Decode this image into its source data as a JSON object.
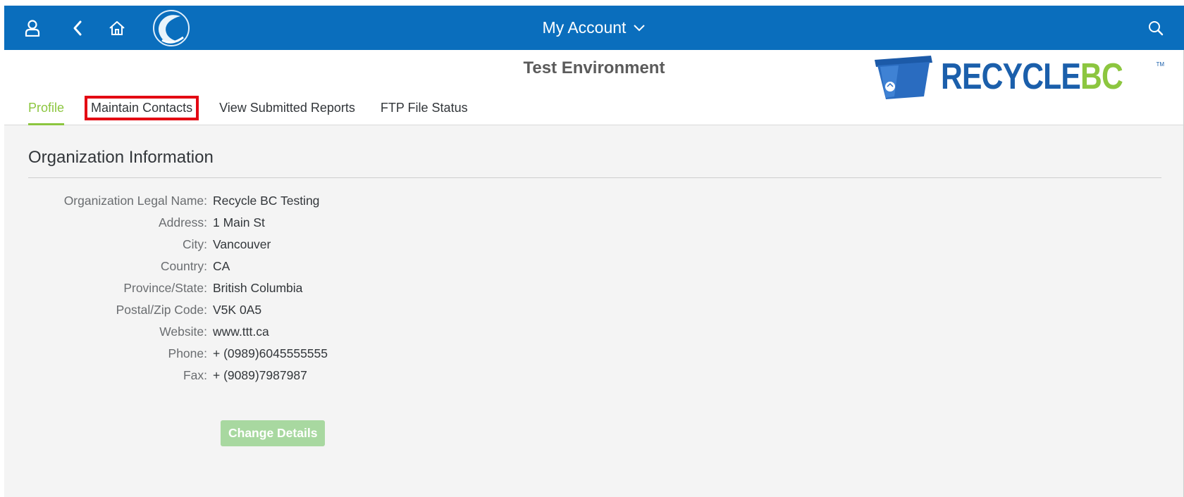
{
  "shell": {
    "title": "My Account",
    "icons": [
      "person-icon",
      "back-icon",
      "home-icon",
      "app-logo",
      "chevron-down-icon",
      "search-icon"
    ],
    "color": "#0a6ebd"
  },
  "header": {
    "environment": "Test Environment",
    "brand": {
      "part1": "RECYCLE",
      "part2": "BC",
      "tm": "TM",
      "colors": {
        "primary": "#1b5fab",
        "accent": "#8cc63f"
      }
    }
  },
  "tabs": [
    {
      "label": "Profile",
      "active": true
    },
    {
      "label": "Maintain Contacts",
      "highlighted": true
    },
    {
      "label": "View Submitted Reports"
    },
    {
      "label": "FTP File Status"
    }
  ],
  "org": {
    "section_title": "Organization Information",
    "fields": [
      {
        "label": "Organization Legal Name:",
        "value": "Recycle BC Testing"
      },
      {
        "label": "Address:",
        "value": "1 Main St"
      },
      {
        "label": "City:",
        "value": "Vancouver"
      },
      {
        "label": "Country:",
        "value": "CA"
      },
      {
        "label": "Province/State:",
        "value": "British Columbia"
      },
      {
        "label": "Postal/Zip Code:",
        "value": "V5K 0A5"
      },
      {
        "label": "Website:",
        "value": "www.ttt.ca"
      },
      {
        "label": "Phone:",
        "value": "+ (0989)6045555555"
      },
      {
        "label": "Fax:",
        "value": "+ (9089)7987987"
      }
    ],
    "change_button": "Change Details"
  }
}
